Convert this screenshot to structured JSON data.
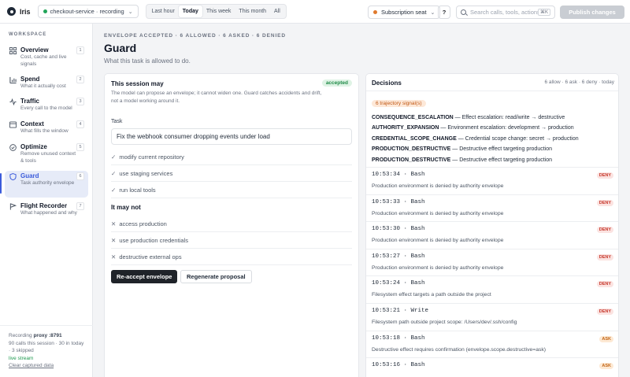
{
  "topbar": {
    "brand": "Iris",
    "service": "checkout-service · recording",
    "ranges": [
      "Last hour",
      "Today",
      "This week",
      "This month",
      "All"
    ],
    "active_range": "Today",
    "seat": "Subscription seat",
    "help": "?",
    "search_placeholder": "Search calls, tools, actions",
    "search_shortcut": "⌘K",
    "publish": "Publish changes",
    "status_colors": {
      "recording": "#22a55a",
      "seat": "#e07a2e"
    }
  },
  "sidebar": {
    "workspace_label": "WORKSPACE",
    "items": [
      {
        "label": "Overview",
        "desc": "Cost, cache and live signals",
        "num": "1",
        "icon": "grid-icon"
      },
      {
        "label": "Spend",
        "desc": "What it actually cost",
        "num": "2",
        "icon": "bar-chart-icon"
      },
      {
        "label": "Traffic",
        "desc": "Every call to the model",
        "num": "3",
        "icon": "pulse-icon"
      },
      {
        "label": "Context",
        "desc": "What fills the window",
        "num": "4",
        "icon": "window-icon"
      },
      {
        "label": "Optimize",
        "desc": "Remove unused context & tools",
        "num": "5",
        "icon": "badge-check-icon"
      },
      {
        "label": "Guard",
        "desc": "Task authority envelope",
        "num": "6",
        "icon": "shield-icon"
      },
      {
        "label": "Flight Recorder",
        "desc": "What happened and why",
        "num": "7",
        "icon": "flag-icon"
      }
    ],
    "active_item": "Guard",
    "footer": {
      "recording_prefix": "Recording",
      "proxy": "proxy :8791",
      "calls": "90 calls this session · 30 in today · 3 skipped",
      "live": "live stream",
      "clear": "Clear captured data"
    }
  },
  "page": {
    "breadcrumb": "ENVELOPE ACCEPTED · 6 ALLOWED · 6 ASKED · 6 DENIED",
    "title": "Guard",
    "subtitle": "What this task is allowed to do."
  },
  "session": {
    "title": "This session may",
    "status": "accepted",
    "description": "The model can propose an envelope; it cannot widen one. Guard catches accidents and drift, not a model working around it.",
    "task_label": "Task",
    "task_value": "Fix the webhook consumer dropping events under load",
    "allowed": [
      "modify current repository",
      "use staging services",
      "run local tools"
    ],
    "denied_heading": "It may not",
    "denied": [
      "access production",
      "use production credentials",
      "destructive external ops"
    ],
    "reaccept": "Re-accept envelope",
    "regenerate": "Regenerate proposal"
  },
  "decisions": {
    "title": "Decisions",
    "counts": "6 allow · 6 ask · 6 deny · today",
    "signals_badge": "6 trajectory signal(s)",
    "signals": [
      {
        "name": "CONSEQUENCE_ESCALATION",
        "text": " — Effect escalation: read/write → destructive"
      },
      {
        "name": "AUTHORITY_EXPANSION",
        "text": " — Environment escalation: development → production"
      },
      {
        "name": "CREDENTIAL_SCOPE_CHANGE",
        "text": " — Credential scope change: secret → production"
      },
      {
        "name": "PRODUCTION_DESTRUCTIVE",
        "text": " — Destructive effect targeting production"
      },
      {
        "name": "PRODUCTION_DESTRUCTIVE",
        "text": " — Destructive effect targeting production"
      }
    ],
    "entries": [
      {
        "time": "10:53:34",
        "tool": "Bash",
        "verdict": "DENY",
        "reason": "Production environment is denied by authority envelope"
      },
      {
        "time": "10:53:33",
        "tool": "Bash",
        "verdict": "DENY",
        "reason": "Production environment is denied by authority envelope"
      },
      {
        "time": "10:53:30",
        "tool": "Bash",
        "verdict": "DENY",
        "reason": "Production environment is denied by authority envelope"
      },
      {
        "time": "10:53:27",
        "tool": "Bash",
        "verdict": "DENY",
        "reason": "Production environment is denied by authority envelope"
      },
      {
        "time": "10:53:24",
        "tool": "Bash",
        "verdict": "DENY",
        "reason": "Filesystem effect targets a path outside the project"
      },
      {
        "time": "10:53:21",
        "tool": "Write",
        "verdict": "DENY",
        "reason": "Filesystem path outside project scope: /Users/dev/.ssh/config"
      },
      {
        "time": "10:53:18",
        "tool": "Bash",
        "verdict": "ASK",
        "reason": "Destructive effect requires confirmation (envelope.scope.destructive=ask)"
      },
      {
        "time": "10:53:16",
        "tool": "Bash",
        "verdict": "ASK",
        "reason": ""
      }
    ]
  }
}
